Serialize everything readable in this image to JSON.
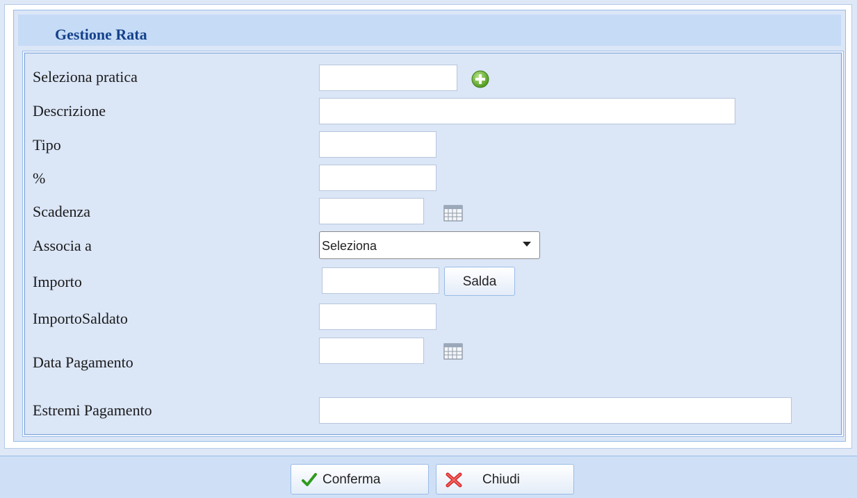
{
  "dialog": {
    "title": "Gestione Rata"
  },
  "form": {
    "seleziona_pratica": {
      "label": "Seleziona pratica",
      "value": ""
    },
    "descrizione": {
      "label": "Descrizione",
      "value": ""
    },
    "tipo": {
      "label": "Tipo",
      "value": ""
    },
    "percentuale": {
      "label": "%",
      "value": ""
    },
    "scadenza": {
      "label": "Scadenza",
      "value": ""
    },
    "associa_a": {
      "label": "Associa a",
      "selected": "Seleziona"
    },
    "importo": {
      "label": "Importo",
      "value": "",
      "button_label": "Salda"
    },
    "importo_saldato": {
      "label": "ImportoSaldato",
      "value": ""
    },
    "data_pagamento": {
      "label": "Data Pagamento",
      "value": ""
    },
    "estremi_pagamento": {
      "label": "Estremi Pagamento",
      "value": ""
    }
  },
  "footer": {
    "confirm_label": "Conferma",
    "close_label": "Chiudi"
  },
  "icons": {
    "add": "add-circle-icon",
    "calendar": "calendar-icon",
    "confirm": "checkmark-icon",
    "close": "red-x-icon"
  },
  "colors": {
    "title": "#15428b",
    "panel_border": "#99bbe8",
    "header_bg": "#c6dbf6"
  }
}
